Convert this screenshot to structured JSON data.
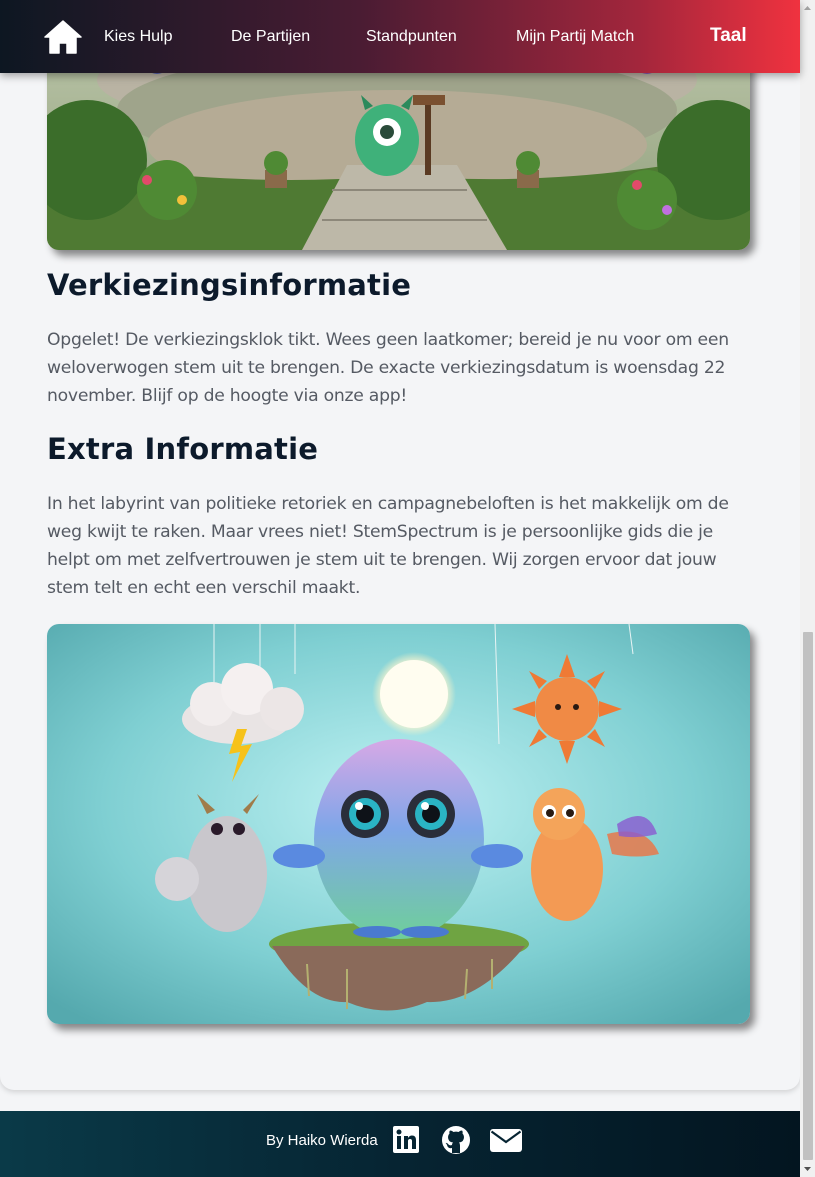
{
  "nav": {
    "home_icon": "home-icon",
    "items": [
      "Kies Hulp",
      "De Partijen",
      "Standpunten",
      "Mijn Partij Match"
    ],
    "language": "Taal"
  },
  "sections": {
    "election": {
      "heading": "Verkiezingsinformatie",
      "text": "Opgelet! De verkiezingsklok tikt. Wees geen laatkomer; bereid je nu voor om een weloverwogen stem uit te brengen. De exacte verkiezingsdatum is woensdag 22 november. Blijf op de hoogte via onze app!"
    },
    "extra": {
      "heading": "Extra Informatie",
      "text": "In het labyrint van politieke retoriek en campagnebeloften is het makkelijk om de weg kwijt te raken. Maar vrees niet! StemSpectrum is je persoonlijke gids die je helpt om met zelfvertrouwen je stem uit te brengen. Wij zorgen ervoor dat jouw stem telt en echt een verschil maakt."
    }
  },
  "footer": {
    "credit": "By Haiko Wierda",
    "icons": [
      "linkedin-icon",
      "github-icon",
      "mail-icon"
    ]
  },
  "colors": {
    "nav_gradient_start": "#0d1722",
    "nav_gradient_end": "#f0323f",
    "heading": "#0c1a2b",
    "body_text": "#555a63",
    "footer_bg": "#062432"
  }
}
